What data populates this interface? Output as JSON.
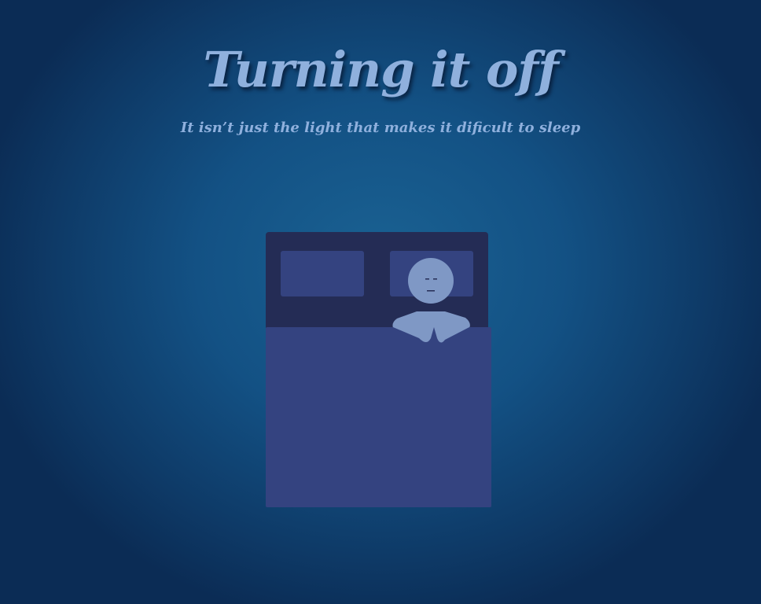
{
  "header": {
    "title": "Turning it off",
    "subtitle": "It isn’t just the light that makes it dificult to sleep"
  },
  "colors": {
    "text": "#8fb0dd",
    "headboard": "#242c55",
    "pillow": "#344380",
    "blanket": "#344380",
    "person": "#7f98c5"
  }
}
